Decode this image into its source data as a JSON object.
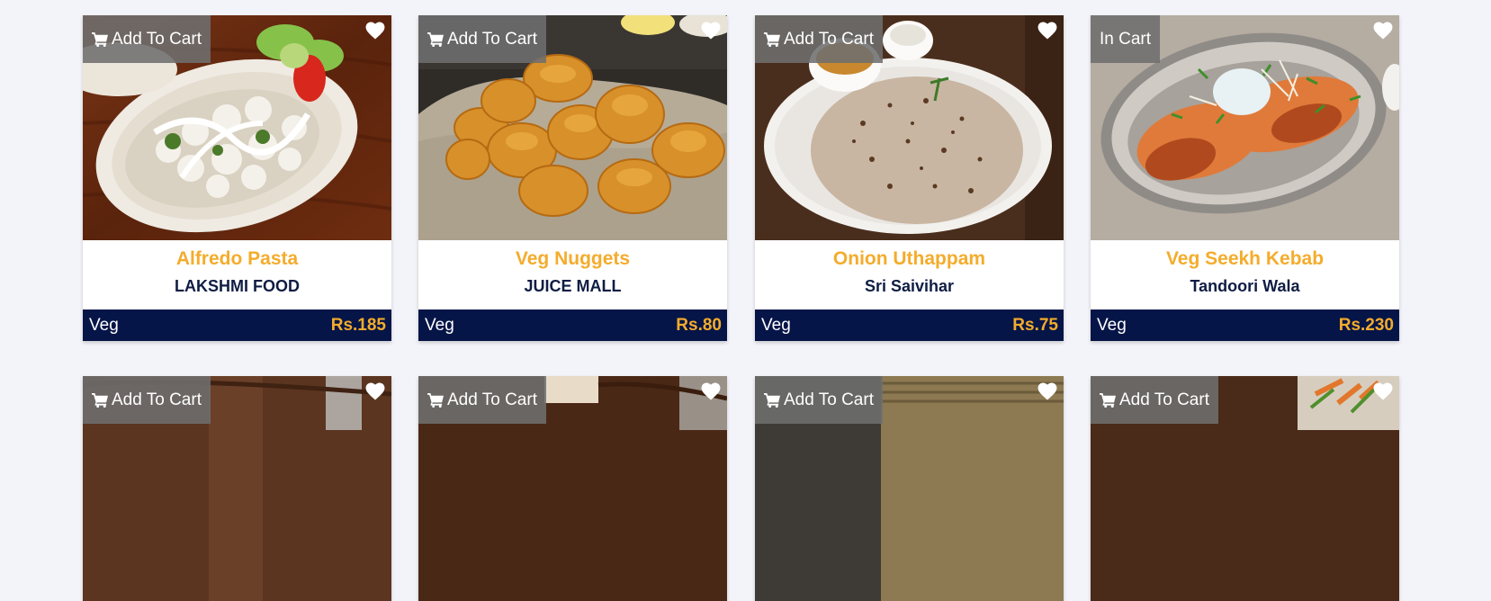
{
  "colors": {
    "page_bg": "#f3f4f9",
    "accent_orange": "#f4ac2c",
    "navy": "#061547",
    "shop_text": "#0f1d44",
    "cart_overlay": "#6e6e6e"
  },
  "icons": {
    "cart": "shopping-cart-icon",
    "favorite": "heart-icon"
  },
  "products": [
    {
      "cart_label": "Add To Cart",
      "name": "Alfredo Pasta",
      "shop": "LAKSHMI FOOD",
      "type": "Veg",
      "price": "Rs.185"
    },
    {
      "cart_label": "Add To Cart",
      "name": "Veg Nuggets",
      "shop": "JUICE MALL",
      "type": "Veg",
      "price": "Rs.80"
    },
    {
      "cart_label": "Add To Cart",
      "name": "Onion Uthappam",
      "shop": "Sri Saivihar",
      "type": "Veg",
      "price": "Rs.75"
    },
    {
      "cart_label": "In Cart",
      "name": "Veg Seekh Kebab",
      "shop": "Tandoori Wala",
      "type": "Veg",
      "price": "Rs.230"
    }
  ],
  "products_row2": [
    {
      "cart_label": "Add To Cart"
    },
    {
      "cart_label": "Add To Cart"
    },
    {
      "cart_label": "Add To Cart"
    },
    {
      "cart_label": "Add To Cart"
    }
  ]
}
